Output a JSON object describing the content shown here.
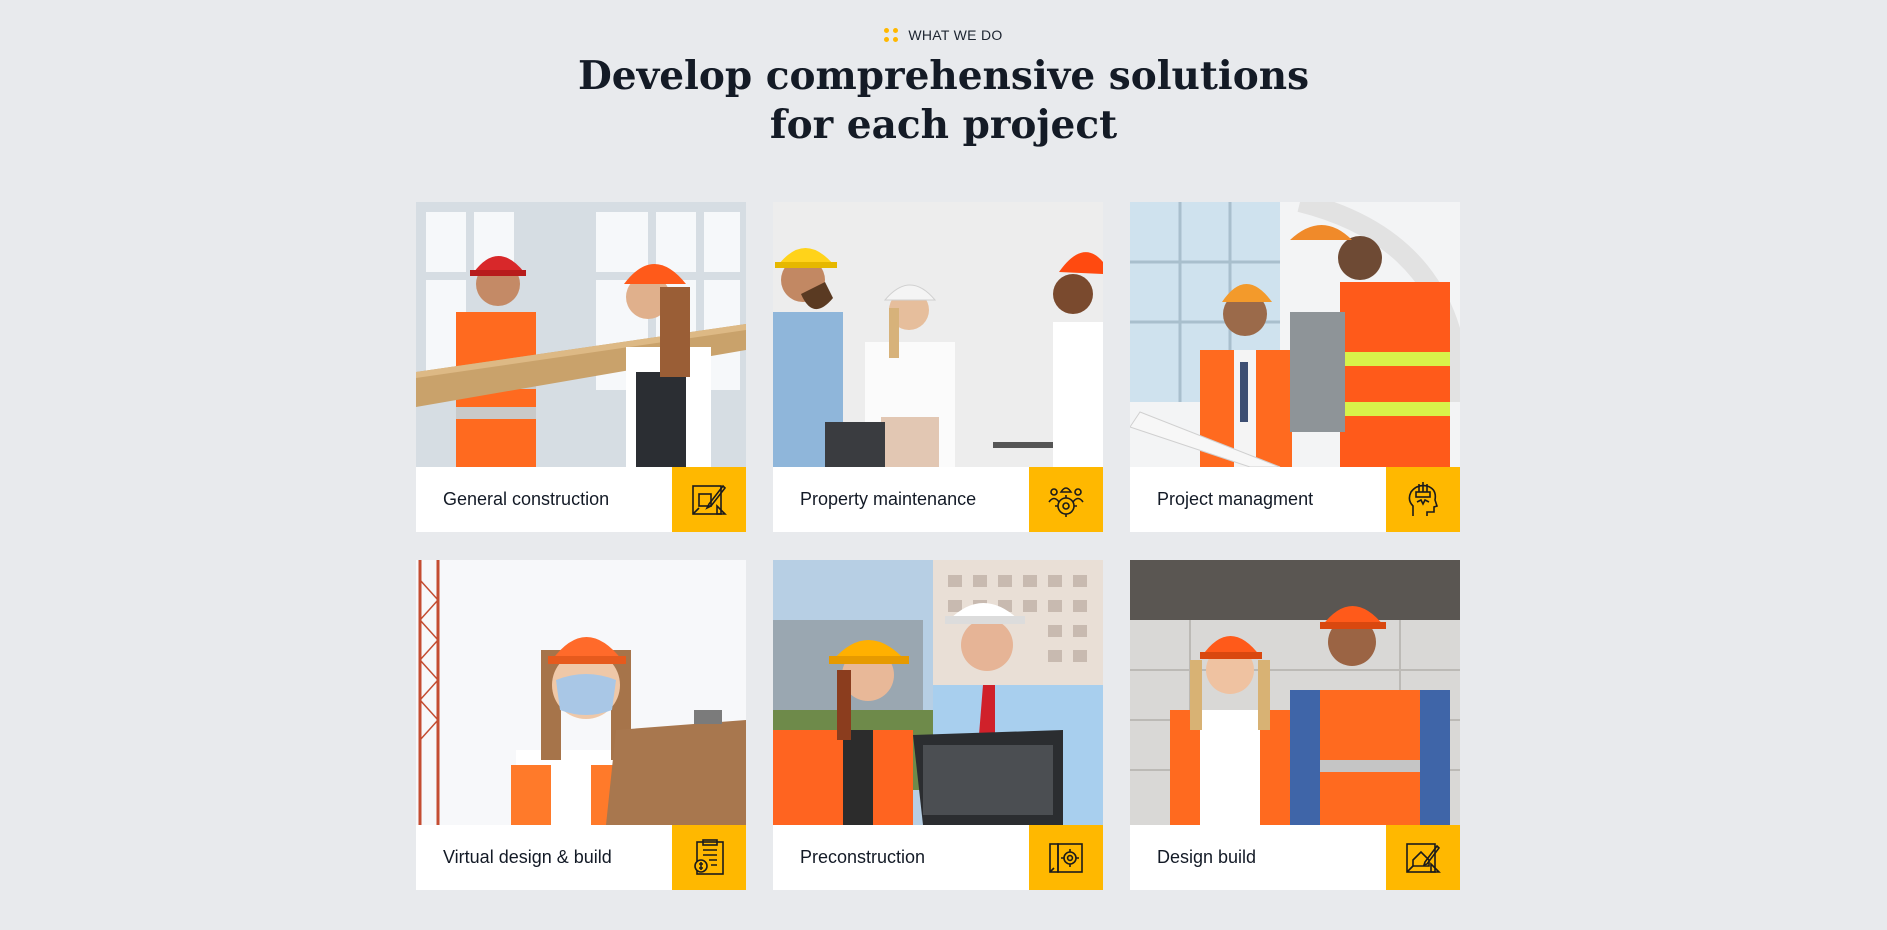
{
  "section": {
    "eyebrow": "WHAT WE DO",
    "headline_line1": "Develop comprehensive solutions",
    "headline_line2": "for each project"
  },
  "colors": {
    "accent": "#ffb800",
    "background": "#e8eaed",
    "heading": "#141b26"
  },
  "services": [
    {
      "title": "General construction",
      "icon": "blueprint-pencil-icon"
    },
    {
      "title": "Property maintenance",
      "icon": "team-gear-icon"
    },
    {
      "title": "Project managment",
      "icon": "head-tools-icon"
    },
    {
      "title": "Virtual design & build",
      "icon": "document-coin-icon"
    },
    {
      "title": "Preconstruction",
      "icon": "blueprint-gear-icon"
    },
    {
      "title": "Design build",
      "icon": "blueprint-house-icon"
    }
  ]
}
